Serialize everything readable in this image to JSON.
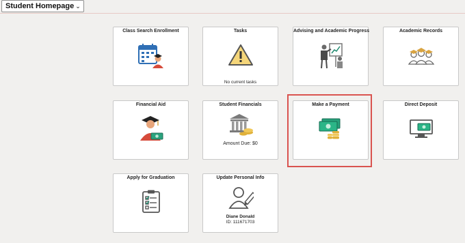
{
  "header": {
    "homepage_label": "Student Homepage",
    "chevron_icon": "chevron-down-icon"
  },
  "tiles": [
    {
      "title": "Class Search Enrollment",
      "icon": "calendar-student-icon"
    },
    {
      "title": "Tasks",
      "icon": "warning-icon",
      "subtitle": "No current tasks"
    },
    {
      "title": "Advising and Academic Progress",
      "icon": "advisor-presentation-icon"
    },
    {
      "title": "Academic Records",
      "icon": "graduates-icon"
    },
    {
      "title": "Financial Aid",
      "icon": "graduate-money-icon"
    },
    {
      "title": "Student Financials",
      "icon": "bank-coins-icon",
      "subtitle": "Amount Due: $0"
    },
    {
      "title": "Make a Payment",
      "icon": "cash-coins-icon"
    },
    {
      "title": "Direct Deposit",
      "icon": "monitor-cash-icon"
    },
    {
      "title": "Apply for Graduation",
      "icon": "clipboard-checklist-icon"
    },
    {
      "title": "Update Personal Info",
      "icon": "user-edit-icon",
      "name": "Diane Donald",
      "id_text": "ID: 111671703"
    }
  ],
  "colors": {
    "highlight": "#d9534f",
    "accent_blue": "#2f6fb5",
    "money_green": "#1f8a6e",
    "coin_gold": "#e0b13a"
  }
}
